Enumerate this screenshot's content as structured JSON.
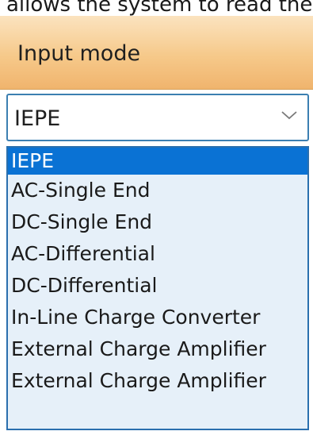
{
  "caption_fragment": "allows the system to read the",
  "header": {
    "title": "Input mode"
  },
  "select": {
    "value": "IEPE",
    "icon": "chevron-down-icon"
  },
  "dropdown": {
    "options": [
      {
        "label": "IEPE",
        "selected": true
      },
      {
        "label": "AC-Single End",
        "selected": false
      },
      {
        "label": "DC-Single End",
        "selected": false
      },
      {
        "label": "AC-Differential",
        "selected": false
      },
      {
        "label": "DC-Differential",
        "selected": false
      },
      {
        "label": "In-Line Charge Converter",
        "selected": false
      },
      {
        "label": "External Charge Amplifier",
        "selected": false
      },
      {
        "label": "External Charge Amplifier",
        "selected": false
      }
    ]
  },
  "colors": {
    "header_gradient_top": "#fbe3bf",
    "header_gradient_bottom": "#f0b46d",
    "select_border": "#3c7fb1",
    "list_background": "#e6f0f9",
    "highlight": "#0a72d4"
  }
}
